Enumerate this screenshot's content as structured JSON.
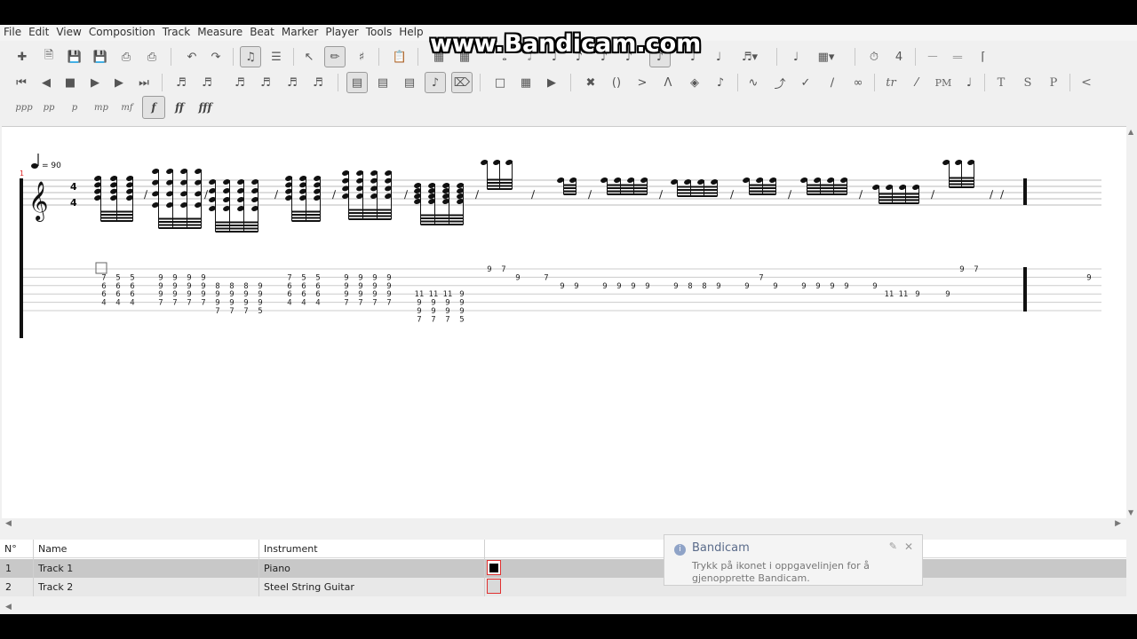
{
  "menu": [
    "File",
    "Edit",
    "View",
    "Composition",
    "Track",
    "Measure",
    "Beat",
    "Marker",
    "Player",
    "Tools",
    "Help"
  ],
  "watermark": "www.Bandicam.com",
  "dynamics": [
    "ppp",
    "pp",
    "p",
    "mp",
    "mf",
    "f",
    "ff",
    "fff"
  ],
  "effects_text": {
    "tr": "tr",
    "pm": "PM",
    "t": "T",
    "s": "S",
    "p": "P",
    "lt": "<"
  },
  "score": {
    "tempo": "= 90",
    "measure_number": "1",
    "time_sig": [
      "4",
      "4"
    ],
    "tab_columns": [
      [
        "7",
        "6",
        "6",
        "4"
      ],
      [
        "5",
        "6",
        "6",
        "4"
      ],
      [
        "5",
        "6",
        "6",
        "4"
      ],
      [
        "9",
        "9",
        "9",
        "7"
      ],
      [
        "9",
        "9",
        "9",
        "7"
      ],
      [
        "9",
        "9",
        "9",
        "7"
      ],
      [
        "9",
        "9",
        "9",
        "7"
      ],
      [
        "8",
        "9",
        "9",
        "7"
      ],
      [
        "8",
        "9",
        "9",
        "7"
      ],
      [
        "8",
        "9",
        "9",
        "7"
      ],
      [
        "9",
        "9",
        "9",
        "5"
      ],
      [
        "7",
        "6",
        "6",
        "4"
      ],
      [
        "5",
        "6",
        "6",
        "4"
      ],
      [
        "5",
        "6",
        "6",
        "4"
      ],
      [
        "9",
        "9",
        "9",
        "7"
      ],
      [
        "9",
        "9",
        "9",
        "7"
      ],
      [
        "9",
        "9",
        "9",
        "7"
      ],
      [
        "9",
        "9",
        "9",
        "7"
      ],
      [
        "11",
        "9",
        "9",
        "7"
      ],
      [
        "11",
        "9",
        "9",
        "7"
      ],
      [
        "11",
        "9",
        "9",
        "7"
      ],
      [
        "9",
        "9",
        "9",
        "5"
      ]
    ],
    "tab_singles": [
      {
        "s": 1,
        "v": "9"
      },
      {
        "s": 1,
        "v": "7"
      },
      {
        "s": 2,
        "v": "9"
      },
      {
        "s": 2,
        "v": "7"
      },
      {
        "s": 3,
        "v": "9"
      },
      {
        "s": 3,
        "v": "9"
      },
      {
        "s": 3,
        "v": "9"
      },
      {
        "s": 3,
        "v": "9"
      },
      {
        "s": 3,
        "v": "9"
      },
      {
        "s": 3,
        "v": "9"
      },
      {
        "s": 3,
        "v": "9"
      },
      {
        "s": 3,
        "v": "8"
      },
      {
        "s": 3,
        "v": "8"
      },
      {
        "s": 3,
        "v": "9"
      },
      {
        "s": 3,
        "v": "9"
      },
      {
        "s": 2,
        "v": "7"
      },
      {
        "s": 3,
        "v": "9"
      },
      {
        "s": 3,
        "v": "9"
      },
      {
        "s": 3,
        "v": "9"
      },
      {
        "s": 3,
        "v": "9"
      },
      {
        "s": 3,
        "v": "9"
      },
      {
        "s": 3,
        "v": "9"
      },
      {
        "s": 4,
        "v": "11"
      },
      {
        "s": 4,
        "v": "11"
      },
      {
        "s": 4,
        "v": "9"
      },
      {
        "s": 4,
        "v": "9"
      },
      {
        "s": 1,
        "v": "9"
      },
      {
        "s": 1,
        "v": "7"
      },
      {
        "s": 2,
        "v": "9"
      }
    ]
  },
  "tracks": {
    "headers": {
      "no": "N°",
      "name": "Name",
      "instrument": "Instrument"
    },
    "rows": [
      {
        "no": "1",
        "name": "Track 1",
        "instrument": "Piano",
        "color": "#000000"
      },
      {
        "no": "2",
        "name": "Track 2",
        "instrument": "Steel String Guitar",
        "color": "#d9d9d9"
      }
    ]
  },
  "notification": {
    "title": "Bandicam",
    "message": "Trykk på ikonet i oppgavelinjen for å gjenopprette Bandicam."
  }
}
